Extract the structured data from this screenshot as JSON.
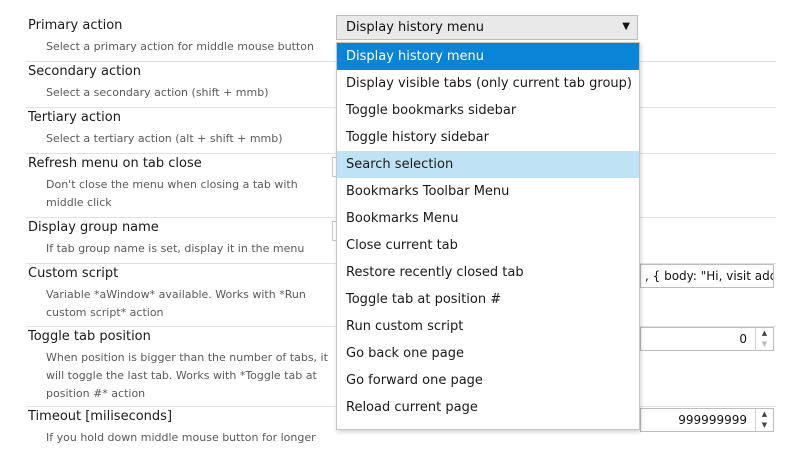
{
  "settings": [
    {
      "title": "Primary action",
      "desc": "Select a primary action for middle mouse button"
    },
    {
      "title": "Secondary action",
      "desc": "Select a secondary action (shift + mmb)"
    },
    {
      "title": "Tertiary action",
      "desc": "Select a tertiary action (alt + shift + mmb)"
    },
    {
      "title": "Refresh menu on tab close",
      "desc": "Don't close the menu when closing a tab with middle click"
    },
    {
      "title": "Display group name",
      "desc": "If tab group name is set, display it in the menu"
    },
    {
      "title": "Custom script",
      "desc": "Variable *aWindow* available. Works with *Run custom script* action"
    },
    {
      "title": "Toggle tab position",
      "desc": "When position is bigger than the number of tabs, it will toggle the last tab. Works with *Toggle tab at position #* action"
    },
    {
      "title": "Timeout [miliseconds]",
      "desc": "If you hold down middle mouse button for longer"
    }
  ],
  "primary_select": {
    "value": "Display history menu",
    "arrow_icon": "triangle-down-icon",
    "options": [
      "Display history menu",
      "Display visible tabs (only current tab group)",
      "Toggle bookmarks sidebar",
      "Toggle history sidebar",
      "Search selection",
      "Bookmarks Toolbar Menu",
      "Bookmarks Menu",
      "Close current tab",
      "Restore recently closed tab",
      "Toggle tab at position #",
      "Run custom script",
      "Go back one page",
      "Go forward one page",
      "Reload current page"
    ],
    "selected_index": 0,
    "hovered_index": 4
  },
  "custom_script_value": ", { body: \"Hi, visit add",
  "toggle_tab_position_value": "0",
  "timeout_value": "999999999",
  "colors": {
    "selected_bg": "#0a84d6",
    "hover_bg": "#bfe3f5",
    "border": "#e2e2e2"
  }
}
